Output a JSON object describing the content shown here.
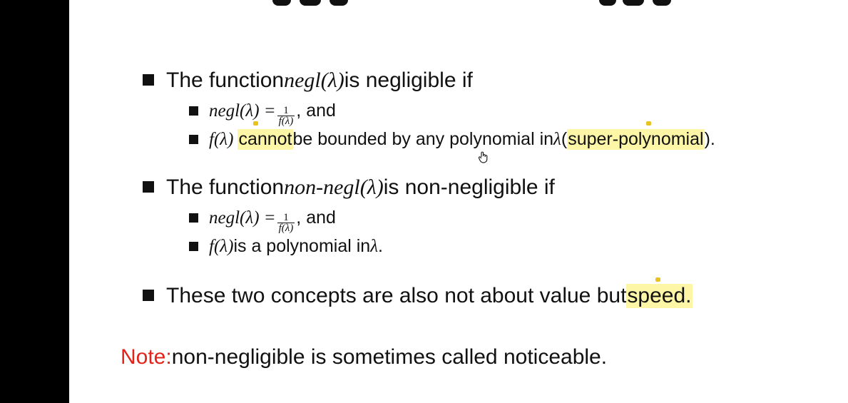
{
  "slide": {
    "b1": {
      "pre": "The function ",
      "math": "negl(λ)",
      "post": " is negligible if",
      "s1": {
        "math": "negl(λ) =",
        "frac_num": "1",
        "frac_den": "f(λ)",
        "post": ", and"
      },
      "s2": {
        "math": "f(λ)",
        "hl1": "cannot",
        "mid": " be bounded by any polynomial in ",
        "lambda": "λ",
        "open": " (",
        "hl2": "super-polynomial",
        "close": ")."
      }
    },
    "b2": {
      "pre": "The function ",
      "math": "non-negl(λ)",
      "post": " is non-negligible if",
      "s1": {
        "math": "negl(λ) =",
        "frac_num": "1",
        "frac_den": "f(λ)",
        "post": ", and"
      },
      "s2": {
        "math": "f(λ)",
        "mid": " is a polynomial in ",
        "lambda": "λ",
        "end": " ."
      }
    },
    "b3": {
      "pre": "These two concepts are also not about value but ",
      "hl": "speed."
    },
    "note": {
      "label": "Note:",
      "text": " non-negligible is sometimes called noticeable."
    }
  },
  "colors": {
    "highlight": "#fdf6a6",
    "note_label": "#e2231a",
    "left_bar": "#000000"
  },
  "icons": {
    "cursor": "hand-cursor-icon",
    "annotation": "sticky-note-pin-icon"
  }
}
